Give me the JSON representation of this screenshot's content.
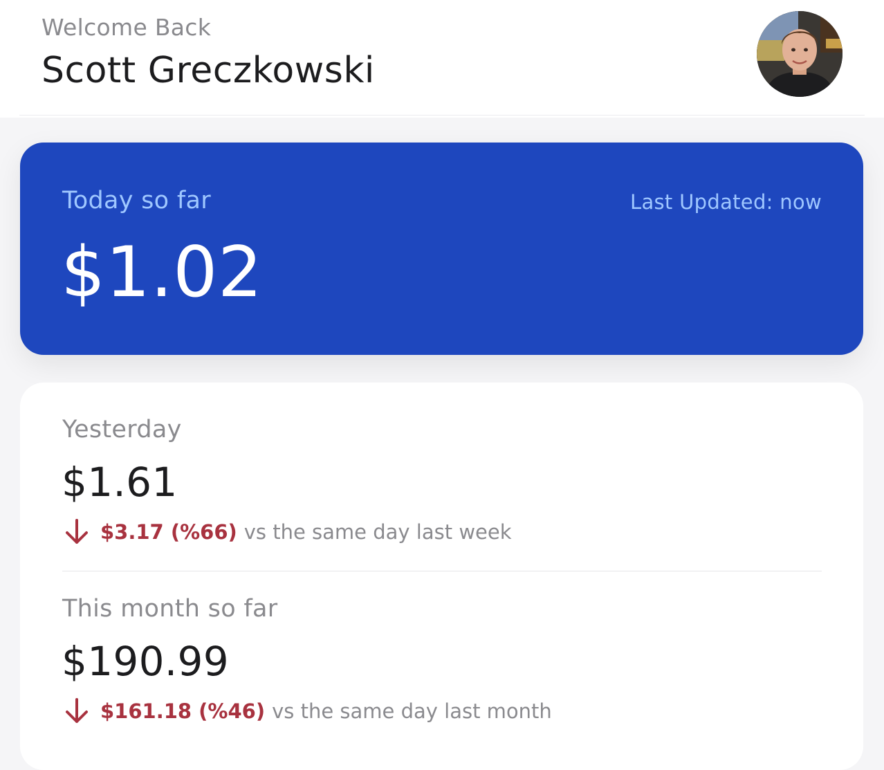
{
  "header": {
    "greeting": "Welcome Back",
    "user_name": "Scott Greczkowski"
  },
  "today": {
    "label": "Today so far",
    "last_updated": "Last Updated: now",
    "value": "$1.02"
  },
  "stats": [
    {
      "label": "Yesterday",
      "value": "$1.61",
      "change_icon": "arrow-down-icon",
      "change_amount": "$3.17 (%66)",
      "change_context": "vs the same day last week"
    },
    {
      "label": "This month so far",
      "value": "$190.99",
      "change_icon": "arrow-down-icon",
      "change_amount": "$161.18 (%46)",
      "change_context": "vs the same day last month"
    }
  ],
  "colors": {
    "accent": "#1e47be",
    "accent_text": "#9fc7ff",
    "negative": "#a8323f",
    "muted": "#8a8a8e",
    "text": "#1c1c1e"
  }
}
